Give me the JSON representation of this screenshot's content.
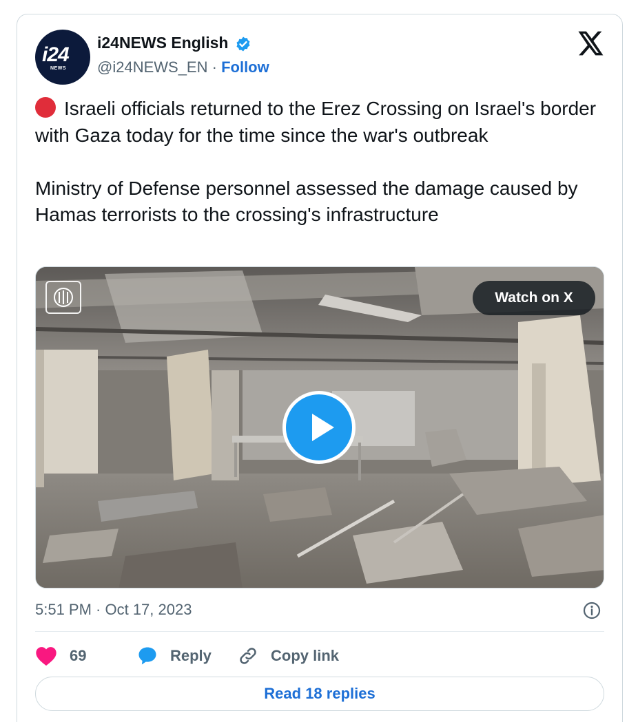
{
  "author": {
    "name": "i24NEWS English",
    "handle": "@i24NEWS_EN",
    "separator": "·",
    "follow_label": "Follow",
    "avatar_text": "i24",
    "avatar_subtext": "NEWS"
  },
  "tweet": {
    "paragraph1": "Israeli officials returned to the Erez Crossing on Israel's border with Gaza today for the time since the war's outbreak",
    "paragraph2": "Ministry of Defense personnel assessed the damage caused by Hamas terrorists to the crossing's infrastructure",
    "leading_emoji": "red-circle-icon"
  },
  "media": {
    "type": "video",
    "watch_label": "Watch on X"
  },
  "meta": {
    "timestamp": "5:51 PM · Oct 17, 2023"
  },
  "actions": {
    "like_count": "69",
    "reply_label": "Reply",
    "copy_label": "Copy link"
  },
  "footer": {
    "read_replies_label": "Read 18 replies"
  },
  "colors": {
    "accent": "#1d9bf0",
    "link": "#1d6fd6",
    "like": "#f91880",
    "muted": "#536471"
  }
}
